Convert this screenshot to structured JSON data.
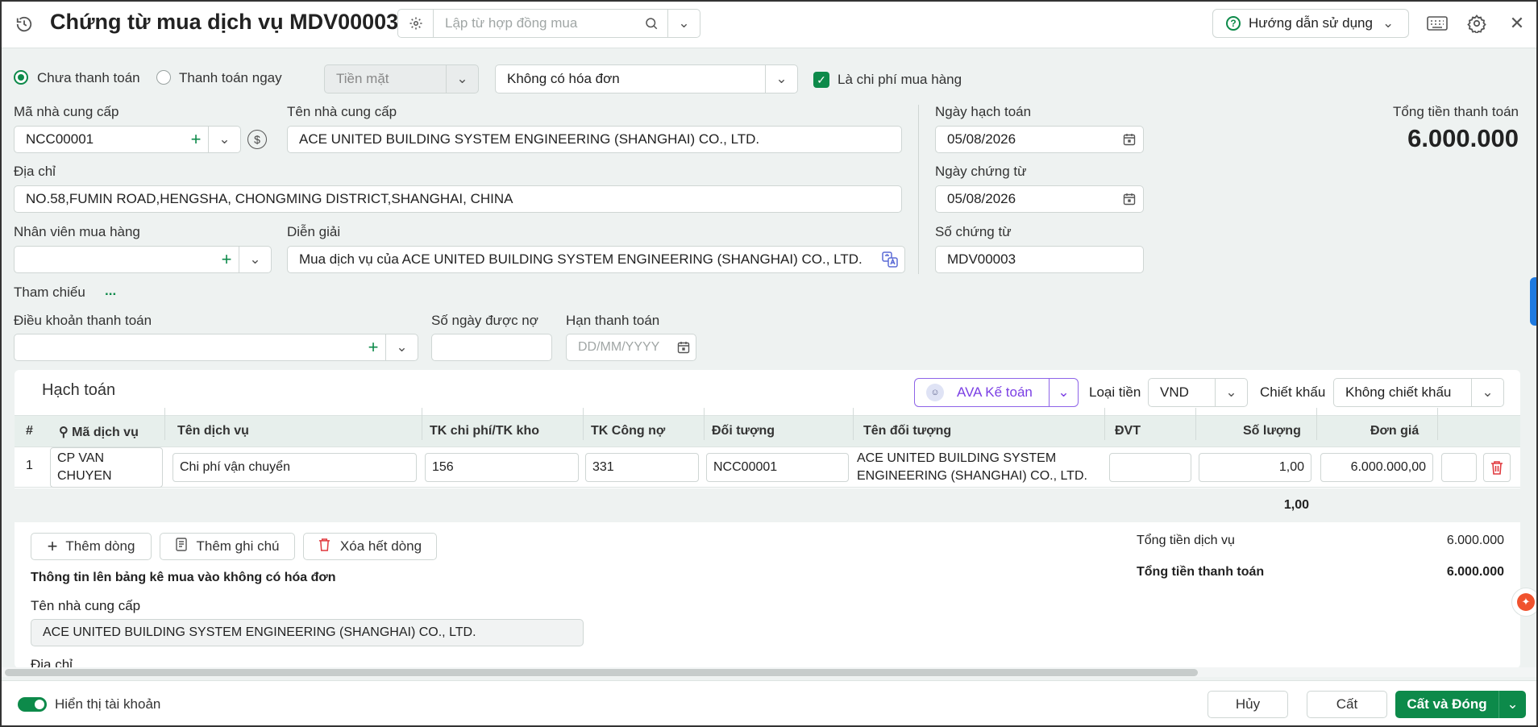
{
  "header": {
    "title": "Chứng từ mua dịch vụ MDV00003",
    "contract_placeholder": "Lập từ hợp đồng mua",
    "help_label": "Hướng dẫn sử dụng"
  },
  "payment": {
    "unpaid_label": "Chưa thanh toán",
    "paid_now_label": "Thanh toán ngay",
    "method_value": "Tiền mặt",
    "invoice_value": "Không có hóa đơn",
    "purchase_cost_label": "Là chi phí mua hàng"
  },
  "form": {
    "supplier_code_label": "Mã nhà cung cấp",
    "supplier_code_value": "NCC00001",
    "supplier_name_label": "Tên nhà cung cấp",
    "supplier_name_value": "ACE UNITED BUILDING SYSTEM ENGINEERING (SHANGHAI) CO., LTD.",
    "address_label": "Địa chỉ",
    "address_value": "NO.58,FUMIN ROAD,HENGSHA, CHONGMING DISTRICT,SHANGHAI, CHINA",
    "employee_label": "Nhân viên mua hàng",
    "employee_value": "",
    "description_label": "Diễn giải",
    "description_value": "Mua dịch vụ của ACE UNITED BUILDING SYSTEM ENGINEERING (SHANGHAI) CO., LTD.",
    "reference_label": "Tham chiếu",
    "reference_more": "...",
    "terms_label": "Điều khoản thanh toán",
    "credit_days_label": "Số ngày được nợ",
    "due_date_label": "Hạn thanh toán",
    "due_date_placeholder": "DD/MM/YYYY",
    "posting_date_label": "Ngày hạch toán",
    "posting_date_value": "05/08/2026",
    "voucher_date_label": "Ngày chứng từ",
    "voucher_date_value": "05/08/2026",
    "voucher_no_label": "Số chứng từ",
    "voucher_no_value": "MDV00003",
    "total_label": "Tổng tiền thanh toán",
    "total_value": "6.000.000"
  },
  "accounting": {
    "title": "Hạch toán",
    "ava_label": "AVA Kế toán",
    "currency_label": "Loại tiền",
    "currency_value": "VND",
    "discount_label": "Chiết khấu",
    "discount_value": "Không chiết khấu",
    "columns": [
      "#",
      "Mã dịch vụ",
      "Tên dịch vụ",
      "TK chi phí/TK kho",
      "TK Công nợ",
      "Đối tượng",
      "Tên đối tượng",
      "ĐVT",
      "Số lượng",
      "Đơn giá"
    ],
    "row": {
      "index": "1",
      "service_code": "CP VAN CHUYEN",
      "service_name": "Chi phí vận chuyển",
      "expense_account": "156",
      "payable_account": "331",
      "object_code": "NCC00001",
      "object_name": "ACE UNITED BUILDING SYSTEM ENGINEERING (SHANGHAI) CO., LTD.",
      "unit": "",
      "quantity": "1,00",
      "unit_price": "6.000.000,00"
    },
    "quantity_total": "1,00",
    "add_row": "Thêm dòng",
    "add_note": "Thêm ghi chú",
    "delete_all": "Xóa hết dòng",
    "service_total_label": "Tổng tiền dịch vụ",
    "service_total_value": "6.000.000",
    "payment_total_label": "Tổng tiền thanh toán",
    "payment_total_value": "6.000.000",
    "listing_title": "Thông tin lên bảng kê mua vào không có hóa đơn",
    "listing_supplier_label": "Tên nhà cung cấp",
    "listing_supplier_value": "ACE UNITED BUILDING SYSTEM ENGINEERING (SHANGHAI) CO., LTD.",
    "listing_address_label": "Địa chỉ"
  },
  "footer": {
    "show_account_label": "Hiển thị tài khoản",
    "cancel": "Hủy",
    "save": "Cất",
    "save_close": "Cất và Đóng"
  },
  "colors": {
    "accent": "#0d8a4a",
    "header_row": "#e7efec",
    "background": "#eef2f1",
    "ava": "#7b3fe4"
  }
}
